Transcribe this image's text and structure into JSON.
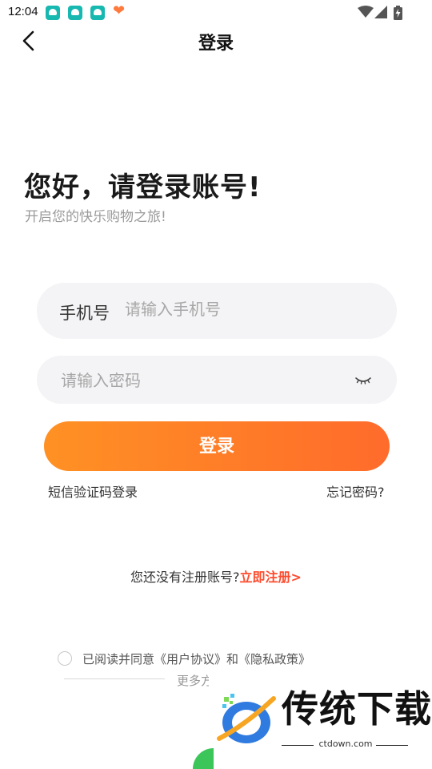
{
  "status_bar": {
    "time": "12:04",
    "notification_icons": [
      "app-notification-icon",
      "app-notification-icon",
      "app-notification-icon",
      "heart-app-icon"
    ],
    "system_icons": [
      "wifi-icon",
      "signal-icon",
      "battery-charging-icon"
    ]
  },
  "header": {
    "title": "登录",
    "back_icon": "chevron-left-icon"
  },
  "greeting": {
    "heading": "您好，请登录账号!",
    "subheading": "开启您的快乐购物之旅!"
  },
  "form": {
    "phone_label": "手机号",
    "phone_placeholder": "请输入手机号",
    "phone_value": "",
    "password_placeholder": "请输入密码",
    "password_value": "",
    "eye_icon": "eye-closed-icon",
    "login_button": "登录",
    "sms_login_link": "短信验证码登录",
    "forgot_link": "忘记密码?"
  },
  "register": {
    "prompt": "您还没有注册账号?",
    "link": "立即注册>"
  },
  "agreement": {
    "text": "已阅读并同意《用户协议》和《隐私政策》",
    "checked": false,
    "more_text": "更多方"
  },
  "watermark": {
    "brand": "传统下载",
    "url": "ctdown.com"
  },
  "colors": {
    "accent_start": "#ff9124",
    "accent_end": "#ff6b2b",
    "register_link": "#ff4a2d",
    "input_bg": "#f4f4f6"
  }
}
